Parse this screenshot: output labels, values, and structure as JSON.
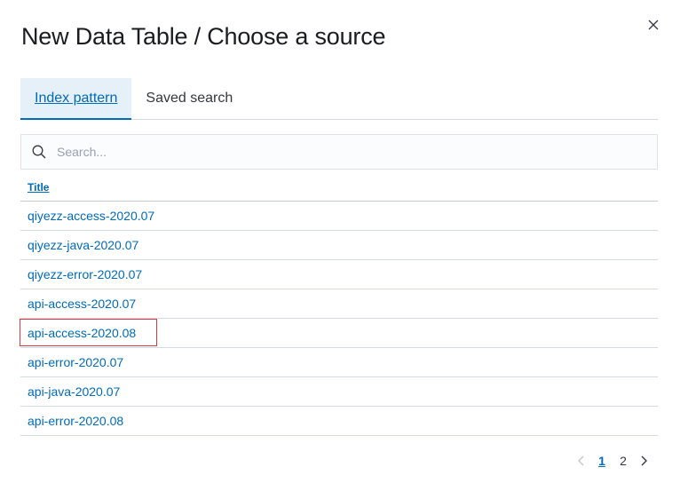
{
  "modal": {
    "title": "New Data Table / Choose a source",
    "close_icon": "close-icon"
  },
  "tabs": [
    {
      "label": "Index pattern",
      "active": true
    },
    {
      "label": "Saved search",
      "active": false
    }
  ],
  "search": {
    "placeholder": "Search...",
    "value": "",
    "icon": "search-icon"
  },
  "table": {
    "column_title": "Title",
    "rows": [
      {
        "title": "qiyezz-access-2020.07"
      },
      {
        "title": "qiyezz-java-2020.07"
      },
      {
        "title": "qiyezz-error-2020.07"
      },
      {
        "title": "api-access-2020.07"
      },
      {
        "title": "api-access-2020.08",
        "highlighted": true
      },
      {
        "title": "api-error-2020.07"
      },
      {
        "title": "api-java-2020.07"
      },
      {
        "title": "api-error-2020.08"
      }
    ]
  },
  "pagination": {
    "pages": [
      "1",
      "2"
    ],
    "current": "1",
    "prev_icon": "chevron-left-icon",
    "next_icon": "chevron-right-icon"
  },
  "colors": {
    "link": "#006bb8",
    "tab_active_bg": "#e6f0f8",
    "highlight_border": "#d9363e"
  }
}
